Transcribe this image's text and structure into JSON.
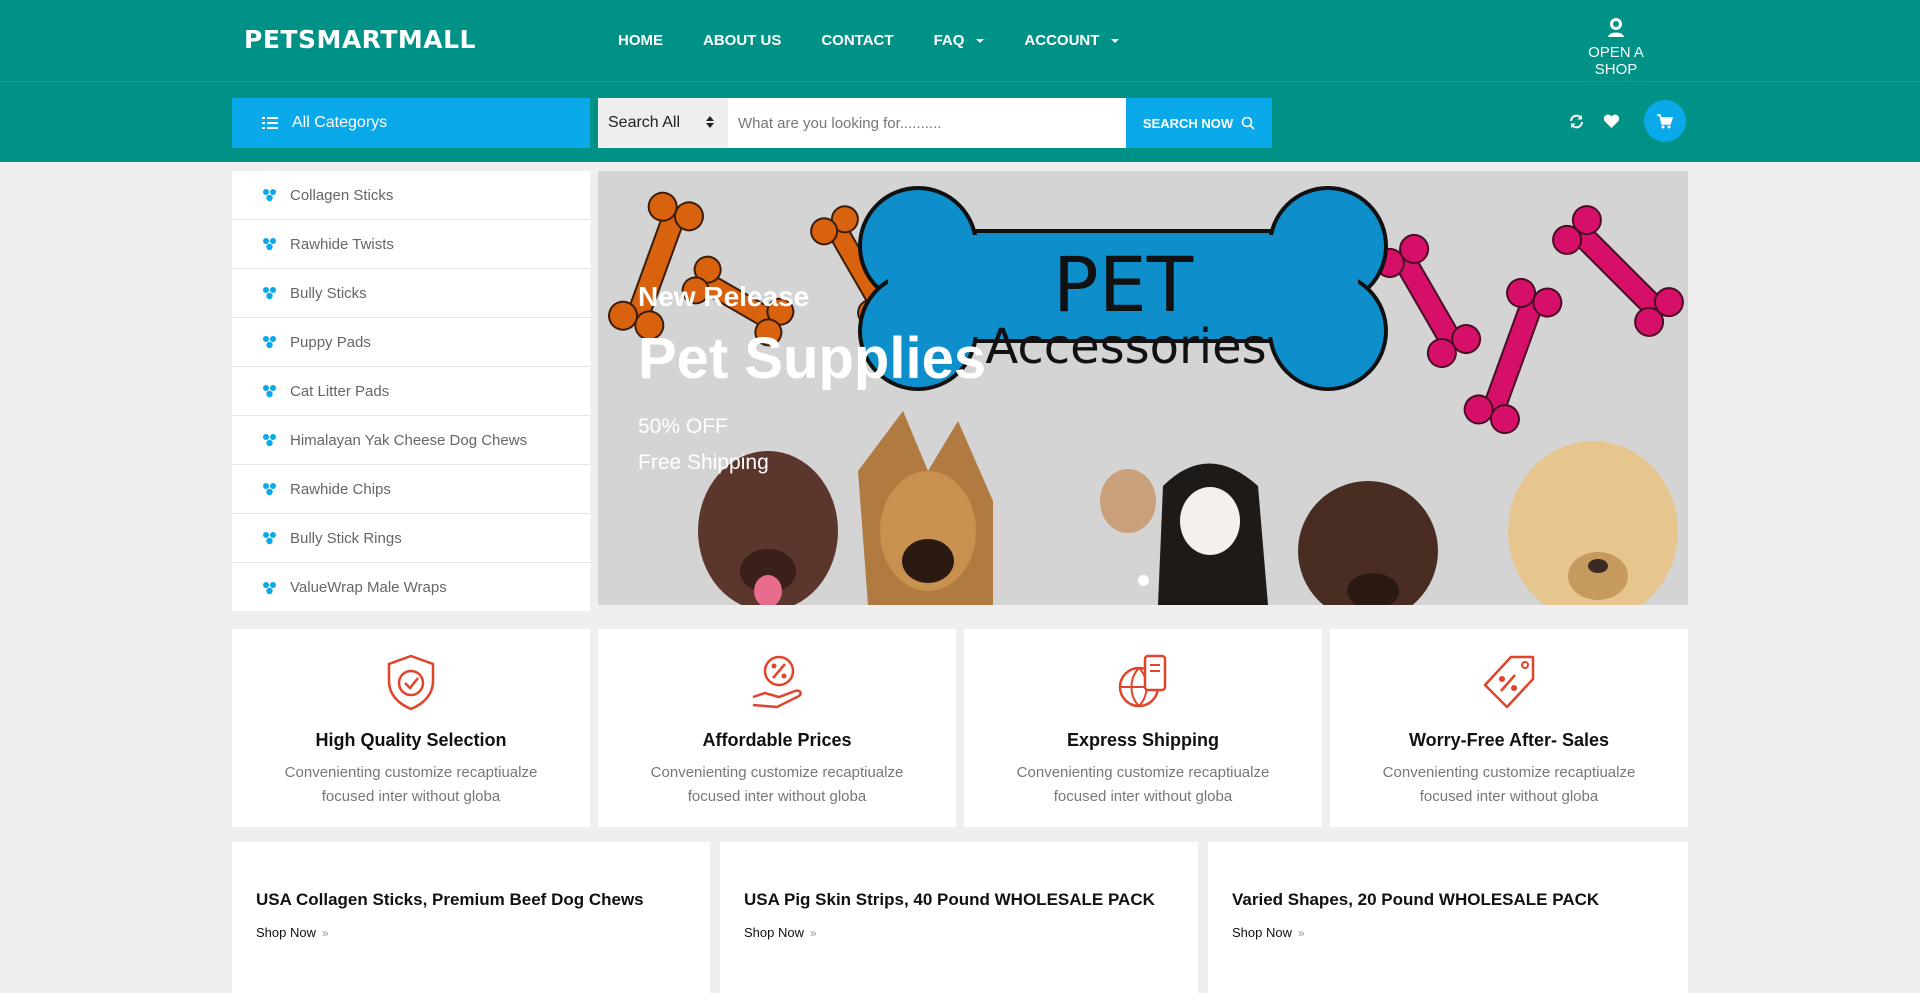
{
  "header": {
    "logo": "PETSMARTMALL",
    "nav": [
      {
        "label": "HOME",
        "dropdown": false
      },
      {
        "label": "ABOUT US",
        "dropdown": false
      },
      {
        "label": "CONTACT",
        "dropdown": false
      },
      {
        "label": "FAQ",
        "dropdown": true
      },
      {
        "label": "ACCOUNT",
        "dropdown": true
      }
    ],
    "open_shop": "OPEN A SHOP"
  },
  "searchbar": {
    "category_button": "All Categorys",
    "select_value": "Search All",
    "placeholder": "What are you looking for..........",
    "button": "SEARCH NOW"
  },
  "sidebar": {
    "items": [
      {
        "label": "Collagen Sticks"
      },
      {
        "label": "Rawhide Twists"
      },
      {
        "label": "Bully Sticks"
      },
      {
        "label": "Puppy Pads"
      },
      {
        "label": "Cat Litter Pads"
      },
      {
        "label": "Himalayan Yak Cheese Dog Chews"
      },
      {
        "label": "Rawhide Chips"
      },
      {
        "label": "Bully Stick Rings"
      },
      {
        "label": "ValueWrap Male Wraps"
      }
    ]
  },
  "banner": {
    "eyebrow": "New Release",
    "title": "Pet Supplies",
    "line1": "50% OFF",
    "line2": "Free Shipping",
    "image_word1": "PET",
    "image_word2": "Accessories"
  },
  "features": [
    {
      "title": "High Quality Selection",
      "desc": "Convenienting customize recaptiualze focused inter without globa",
      "icon": "shield-check-icon"
    },
    {
      "title": "Affordable Prices",
      "desc": "Convenienting customize recaptiualze focused inter without globa",
      "icon": "hand-percent-icon"
    },
    {
      "title": "Express Shipping",
      "desc": "Convenienting customize recaptiualze focused inter without globa",
      "icon": "globe-shipping-icon"
    },
    {
      "title": "Worry-Free After- Sales",
      "desc": "Convenienting customize recaptiualze focused inter without globa",
      "icon": "price-tag-icon"
    }
  ],
  "promos": [
    {
      "title": "USA Collagen Sticks, Premium Beef Dog Chews",
      "link": "Shop Now"
    },
    {
      "title": "USA Pig Skin Strips, 40 Pound WHOLESALE PACK",
      "link": "Shop Now"
    },
    {
      "title": "Varied Shapes, 20 Pound WHOLESALE PACK",
      "link": "Shop Now"
    }
  ],
  "colors": {
    "teal": "#009286",
    "blue": "#0aa9e9",
    "feature_icon": "#e0452b"
  }
}
